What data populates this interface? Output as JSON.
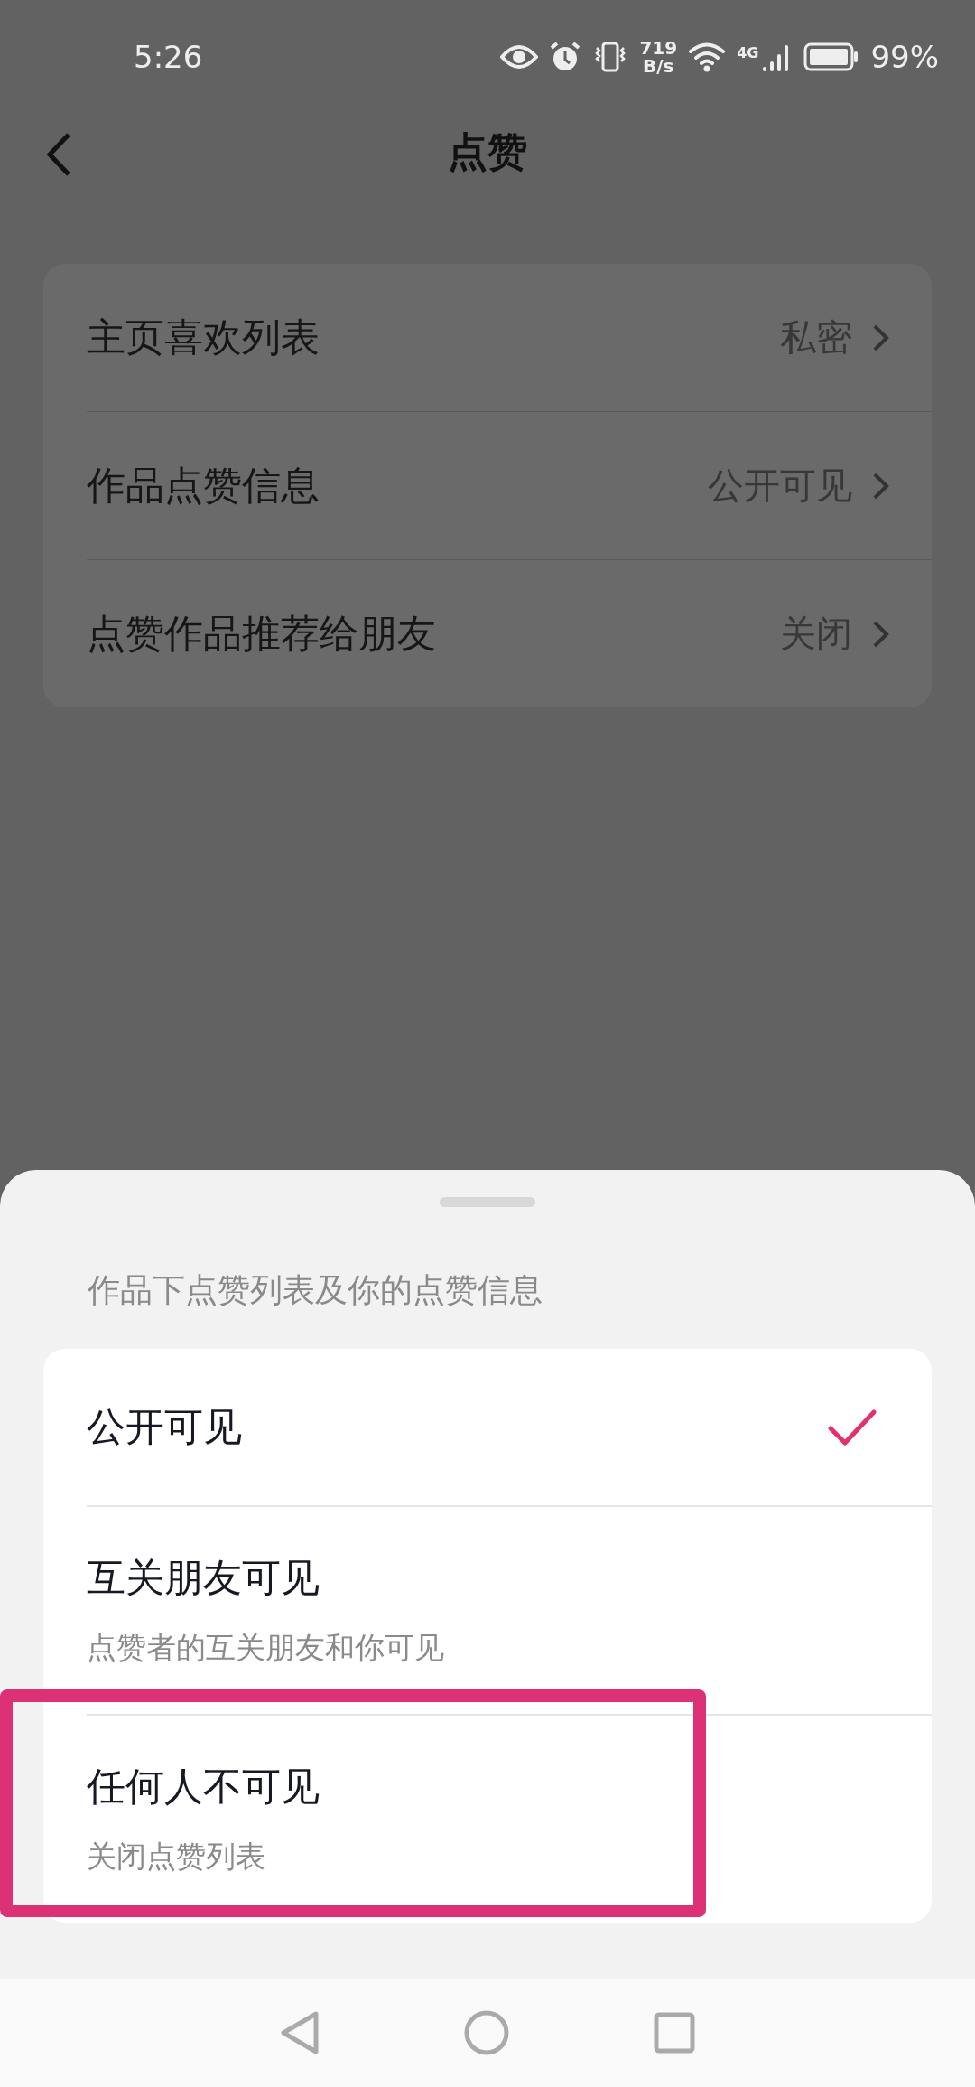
{
  "status_bar": {
    "time": "5:26",
    "net_speed_value": "719",
    "net_speed_unit": "B/s",
    "network": "4G",
    "battery": "99%"
  },
  "header": {
    "title": "点赞"
  },
  "settings": [
    {
      "label": "主页喜欢列表",
      "value": "私密"
    },
    {
      "label": "作品点赞信息",
      "value": "公开可见"
    },
    {
      "label": "点赞作品推荐给朋友",
      "value": "关闭"
    }
  ],
  "sheet": {
    "caption": "作品下点赞列表及你的点赞信息",
    "options": [
      {
        "label": "公开可见",
        "selected": true,
        "highlighted": false
      },
      {
        "label": "互关朋友可见",
        "description": "点赞者的互关朋友和你可见",
        "selected": false,
        "highlighted": false
      },
      {
        "label": "任何人不可见",
        "description": "关闭点赞列表",
        "selected": false,
        "highlighted": true
      }
    ]
  }
}
